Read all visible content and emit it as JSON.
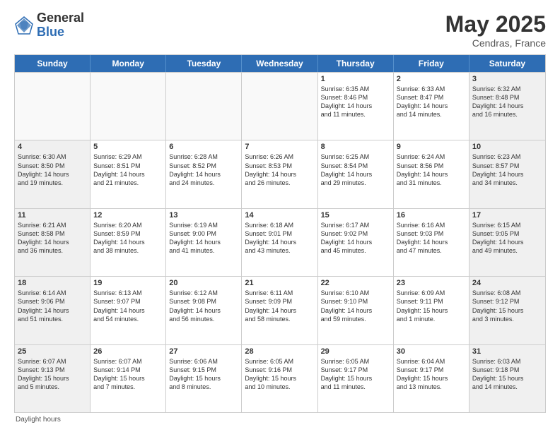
{
  "logo": {
    "general": "General",
    "blue": "Blue"
  },
  "title": {
    "month": "May 2025",
    "location": "Cendras, France"
  },
  "header": {
    "days": [
      "Sunday",
      "Monday",
      "Tuesday",
      "Wednesday",
      "Thursday",
      "Friday",
      "Saturday"
    ]
  },
  "weeks": [
    [
      {
        "day": "",
        "info": ""
      },
      {
        "day": "",
        "info": ""
      },
      {
        "day": "",
        "info": ""
      },
      {
        "day": "",
        "info": ""
      },
      {
        "day": "1",
        "info": "Sunrise: 6:35 AM\nSunset: 8:46 PM\nDaylight: 14 hours\nand 11 minutes."
      },
      {
        "day": "2",
        "info": "Sunrise: 6:33 AM\nSunset: 8:47 PM\nDaylight: 14 hours\nand 14 minutes."
      },
      {
        "day": "3",
        "info": "Sunrise: 6:32 AM\nSunset: 8:48 PM\nDaylight: 14 hours\nand 16 minutes."
      }
    ],
    [
      {
        "day": "4",
        "info": "Sunrise: 6:30 AM\nSunset: 8:50 PM\nDaylight: 14 hours\nand 19 minutes."
      },
      {
        "day": "5",
        "info": "Sunrise: 6:29 AM\nSunset: 8:51 PM\nDaylight: 14 hours\nand 21 minutes."
      },
      {
        "day": "6",
        "info": "Sunrise: 6:28 AM\nSunset: 8:52 PM\nDaylight: 14 hours\nand 24 minutes."
      },
      {
        "day": "7",
        "info": "Sunrise: 6:26 AM\nSunset: 8:53 PM\nDaylight: 14 hours\nand 26 minutes."
      },
      {
        "day": "8",
        "info": "Sunrise: 6:25 AM\nSunset: 8:54 PM\nDaylight: 14 hours\nand 29 minutes."
      },
      {
        "day": "9",
        "info": "Sunrise: 6:24 AM\nSunset: 8:56 PM\nDaylight: 14 hours\nand 31 minutes."
      },
      {
        "day": "10",
        "info": "Sunrise: 6:23 AM\nSunset: 8:57 PM\nDaylight: 14 hours\nand 34 minutes."
      }
    ],
    [
      {
        "day": "11",
        "info": "Sunrise: 6:21 AM\nSunset: 8:58 PM\nDaylight: 14 hours\nand 36 minutes."
      },
      {
        "day": "12",
        "info": "Sunrise: 6:20 AM\nSunset: 8:59 PM\nDaylight: 14 hours\nand 38 minutes."
      },
      {
        "day": "13",
        "info": "Sunrise: 6:19 AM\nSunset: 9:00 PM\nDaylight: 14 hours\nand 41 minutes."
      },
      {
        "day": "14",
        "info": "Sunrise: 6:18 AM\nSunset: 9:01 PM\nDaylight: 14 hours\nand 43 minutes."
      },
      {
        "day": "15",
        "info": "Sunrise: 6:17 AM\nSunset: 9:02 PM\nDaylight: 14 hours\nand 45 minutes."
      },
      {
        "day": "16",
        "info": "Sunrise: 6:16 AM\nSunset: 9:03 PM\nDaylight: 14 hours\nand 47 minutes."
      },
      {
        "day": "17",
        "info": "Sunrise: 6:15 AM\nSunset: 9:05 PM\nDaylight: 14 hours\nand 49 minutes."
      }
    ],
    [
      {
        "day": "18",
        "info": "Sunrise: 6:14 AM\nSunset: 9:06 PM\nDaylight: 14 hours\nand 51 minutes."
      },
      {
        "day": "19",
        "info": "Sunrise: 6:13 AM\nSunset: 9:07 PM\nDaylight: 14 hours\nand 54 minutes."
      },
      {
        "day": "20",
        "info": "Sunrise: 6:12 AM\nSunset: 9:08 PM\nDaylight: 14 hours\nand 56 minutes."
      },
      {
        "day": "21",
        "info": "Sunrise: 6:11 AM\nSunset: 9:09 PM\nDaylight: 14 hours\nand 58 minutes."
      },
      {
        "day": "22",
        "info": "Sunrise: 6:10 AM\nSunset: 9:10 PM\nDaylight: 14 hours\nand 59 minutes."
      },
      {
        "day": "23",
        "info": "Sunrise: 6:09 AM\nSunset: 9:11 PM\nDaylight: 15 hours\nand 1 minute."
      },
      {
        "day": "24",
        "info": "Sunrise: 6:08 AM\nSunset: 9:12 PM\nDaylight: 15 hours\nand 3 minutes."
      }
    ],
    [
      {
        "day": "25",
        "info": "Sunrise: 6:07 AM\nSunset: 9:13 PM\nDaylight: 15 hours\nand 5 minutes."
      },
      {
        "day": "26",
        "info": "Sunrise: 6:07 AM\nSunset: 9:14 PM\nDaylight: 15 hours\nand 7 minutes."
      },
      {
        "day": "27",
        "info": "Sunrise: 6:06 AM\nSunset: 9:15 PM\nDaylight: 15 hours\nand 8 minutes."
      },
      {
        "day": "28",
        "info": "Sunrise: 6:05 AM\nSunset: 9:16 PM\nDaylight: 15 hours\nand 10 minutes."
      },
      {
        "day": "29",
        "info": "Sunrise: 6:05 AM\nSunset: 9:17 PM\nDaylight: 15 hours\nand 11 minutes."
      },
      {
        "day": "30",
        "info": "Sunrise: 6:04 AM\nSunset: 9:17 PM\nDaylight: 15 hours\nand 13 minutes."
      },
      {
        "day": "31",
        "info": "Sunrise: 6:03 AM\nSunset: 9:18 PM\nDaylight: 15 hours\nand 14 minutes."
      }
    ]
  ],
  "footer": {
    "note": "Daylight hours"
  }
}
